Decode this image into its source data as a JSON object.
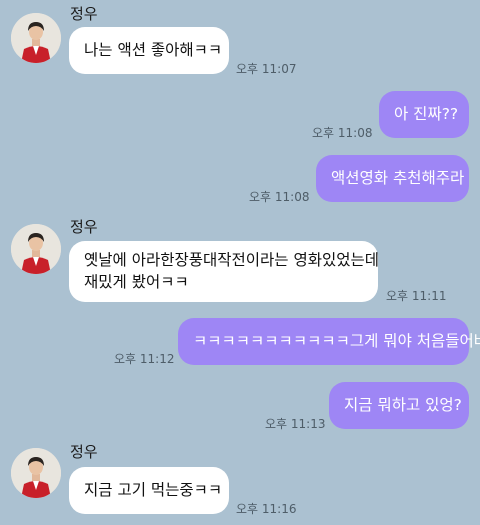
{
  "chat": {
    "partner_name": "정우",
    "messages": [
      {
        "direction": "in",
        "text": "나는 액션 좋아해ㅋㅋ",
        "time": "오후 11:07"
      },
      {
        "direction": "out",
        "text": "아 진짜??",
        "time": "오후 11:08"
      },
      {
        "direction": "out",
        "text": "액션영화 추천해주라",
        "time": "오후 11:08"
      },
      {
        "direction": "in",
        "line1": "옛날에 아라한장풍대작전이라는 영화있었는데",
        "line2": "재밌게 봤어ㅋㅋ",
        "time": "오후 11:11"
      },
      {
        "direction": "out",
        "text": "ㅋㅋㅋㅋㅋㅋㅋㅋㅋㅋㅋ그게 뭐야 처음들어바",
        "time": "오후 11:12"
      },
      {
        "direction": "out",
        "text": "지금 뭐하고 있엉?",
        "time": "오후 11:13"
      },
      {
        "direction": "in",
        "text": "지금 고기 먹는중ㅋㅋ",
        "time": "오후 11:16"
      }
    ]
  },
  "colors": {
    "background": "#abc1d1",
    "outgoing_bubble": "#9e86f5",
    "incoming_bubble": "#ffffff"
  },
  "icons": {
    "avatar": "profile-photo-avatar"
  }
}
